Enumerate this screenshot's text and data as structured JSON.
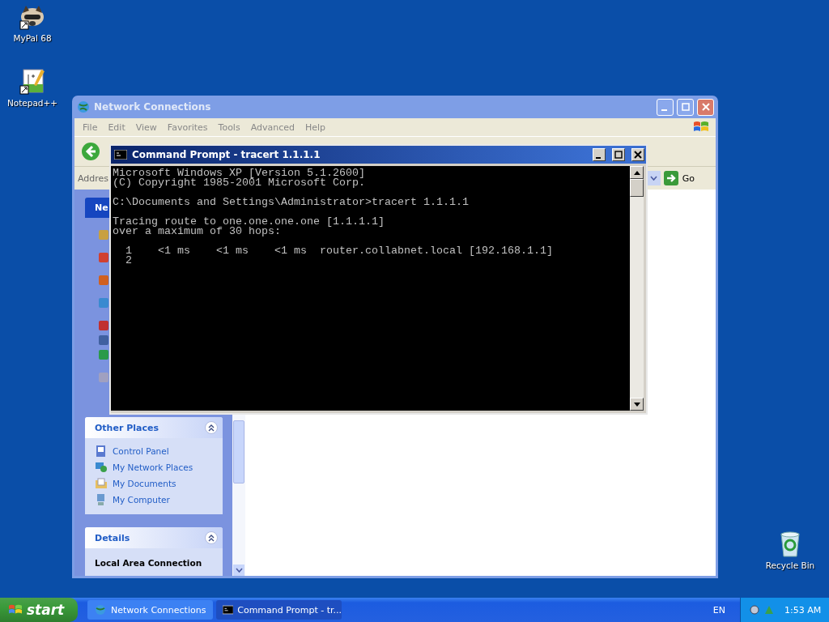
{
  "desktop_icons": [
    {
      "label": "MyPal 68",
      "kind": "raccoon"
    },
    {
      "label": "Notepad++",
      "kind": "notepad"
    },
    {
      "label": "Recycle Bin",
      "kind": "bin"
    }
  ],
  "explorer": {
    "title": "Network Connections",
    "menu": [
      "File",
      "Edit",
      "View",
      "Favorites",
      "Tools",
      "Advanced",
      "Help"
    ],
    "address_label": "Addres",
    "go": "Go",
    "task_pane": {
      "first_title": "Ne",
      "other_places": {
        "title": "Other Places",
        "items": [
          {
            "label": "Control Panel",
            "kind": "panel"
          },
          {
            "label": "My Network Places",
            "kind": "network"
          },
          {
            "label": "My Documents",
            "kind": "folder"
          },
          {
            "label": "My Computer",
            "kind": "computer"
          }
        ]
      },
      "details": {
        "title": "Details",
        "name": "Local Area Connection"
      }
    }
  },
  "console": {
    "title": "Command Prompt - tracert 1.1.1.1",
    "blocks": [
      [
        "Microsoft Windows XP [Version 5.1.2600]",
        "(C) Copyright 1985-2001 Microsoft Corp."
      ],
      [
        "C:\\Documents and Settings\\Administrator>tracert 1.1.1.1"
      ],
      [
        "Tracing route to one.one.one.one [1.1.1.1]",
        "over a maximum of 30 hops:"
      ],
      [
        "  1    <1 ms    <1 ms    <1 ms  router.collabnet.local [192.168.1.1]",
        "  2"
      ]
    ]
  },
  "taskbar": {
    "start": "start",
    "tasks": [
      {
        "label": "Network Connections",
        "kind": "network",
        "selected": false
      },
      {
        "label": "Command Prompt - tr...",
        "kind": "console",
        "selected": true
      }
    ],
    "language": "EN",
    "clock": "1:53 AM"
  }
}
